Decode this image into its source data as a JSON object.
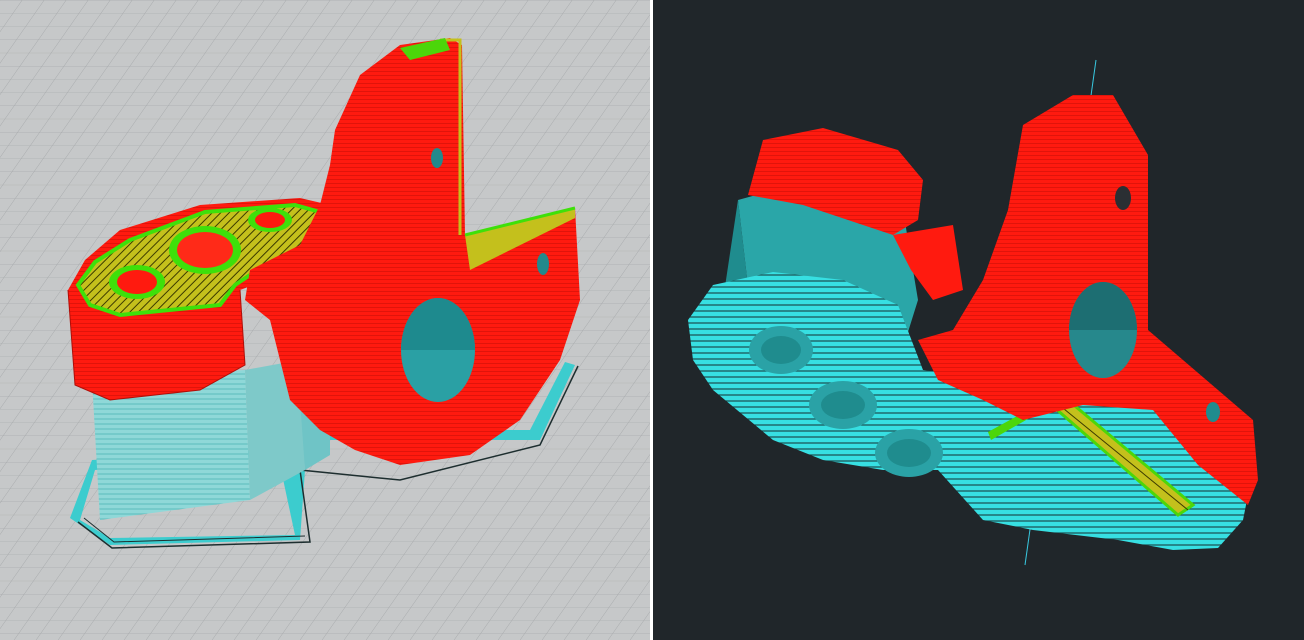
{
  "colors": {
    "perimeter": "#ff1a0f",
    "perimeter_shade": "#d40f08",
    "infill": "#b6b81e",
    "infill_line": "#343400",
    "solid_infill": "#4cd60a",
    "support_skirt": "#38e4e8",
    "support_shade": "#2aa0a4",
    "bed_light": "#c6c8c9",
    "bed_grid": "#9ea2a4",
    "dark_bg": "#20262a"
  },
  "views": [
    {
      "id": "left",
      "background": "light-grid-bed"
    },
    {
      "id": "right",
      "background": "dark"
    }
  ]
}
